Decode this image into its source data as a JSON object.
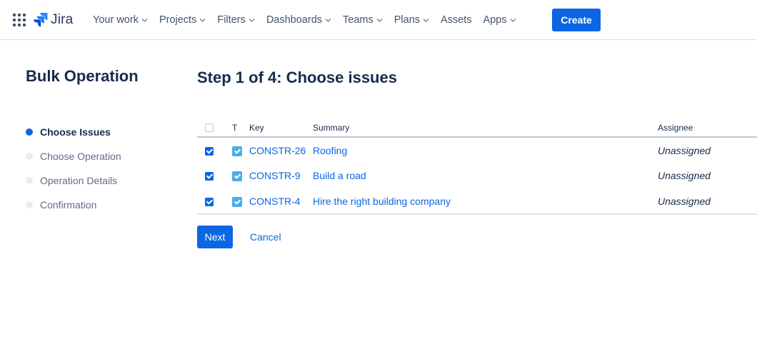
{
  "nav": {
    "product": "Jira",
    "items": [
      {
        "label": "Your work",
        "has_menu": true
      },
      {
        "label": "Projects",
        "has_menu": true
      },
      {
        "label": "Filters",
        "has_menu": true
      },
      {
        "label": "Dashboards",
        "has_menu": true
      },
      {
        "label": "Teams",
        "has_menu": true
      },
      {
        "label": "Plans",
        "has_menu": true
      },
      {
        "label": "Assets",
        "has_menu": false
      },
      {
        "label": "Apps",
        "has_menu": true
      }
    ],
    "create_label": "Create"
  },
  "sidebar": {
    "title": "Bulk Operation",
    "steps": [
      {
        "label": "Choose Issues",
        "active": true
      },
      {
        "label": "Choose Operation",
        "active": false
      },
      {
        "label": "Operation Details",
        "active": false
      },
      {
        "label": "Confirmation",
        "active": false
      }
    ]
  },
  "main": {
    "title": "Step 1 of 4: Choose issues",
    "columns": {
      "type": "T",
      "key": "Key",
      "summary": "Summary",
      "assignee": "Assignee"
    },
    "rows": [
      {
        "checked": true,
        "type": "task-icon",
        "key": "CONSTR-26",
        "summary": "Roofing",
        "assignee": "Unassigned"
      },
      {
        "checked": true,
        "type": "task-icon",
        "key": "CONSTR-9",
        "summary": "Build a road",
        "assignee": "Unassigned"
      },
      {
        "checked": true,
        "type": "task-icon",
        "key": "CONSTR-4",
        "summary": "Hire the right building company",
        "assignee": "Unassigned"
      }
    ],
    "next_label": "Next",
    "cancel_label": "Cancel"
  },
  "colors": {
    "accent": "#0c66e4",
    "text": "#172b4d",
    "muted": "#5e6c84",
    "task_icon": "#4bade8"
  }
}
